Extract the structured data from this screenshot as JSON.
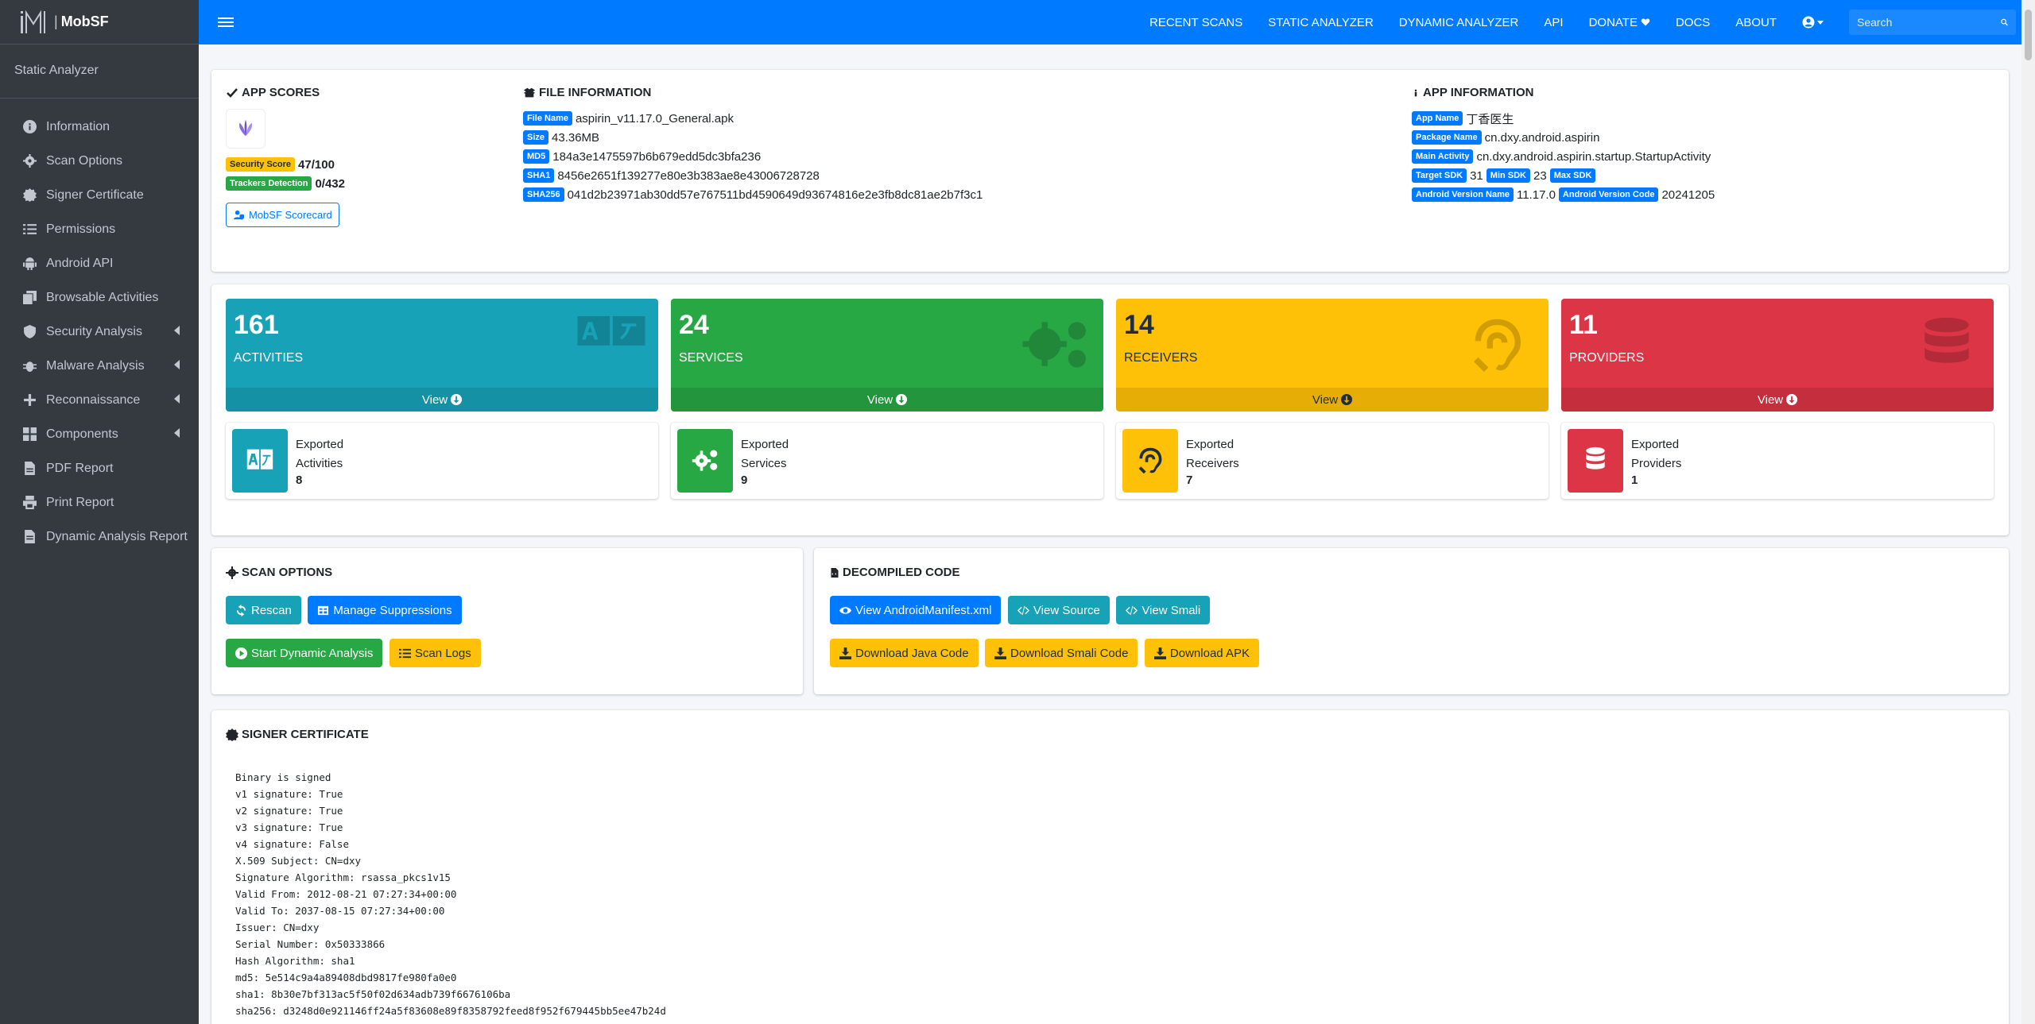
{
  "brand": {
    "name": "MobSF"
  },
  "sidebar": {
    "title": "Static Analyzer",
    "items": [
      {
        "label": "Information",
        "icon": "info-circle-icon",
        "submenu": false
      },
      {
        "label": "Scan Options",
        "icon": "cog-icon",
        "submenu": false
      },
      {
        "label": "Signer Certificate",
        "icon": "certificate-icon",
        "submenu": false
      },
      {
        "label": "Permissions",
        "icon": "list-icon",
        "submenu": false
      },
      {
        "label": "Android API",
        "icon": "android-icon",
        "submenu": false
      },
      {
        "label": "Browsable Activities",
        "icon": "clone-icon",
        "submenu": false
      },
      {
        "label": "Security Analysis",
        "icon": "shield-icon",
        "submenu": true
      },
      {
        "label": "Malware Analysis",
        "icon": "bug-icon",
        "submenu": true
      },
      {
        "label": "Reconnaissance",
        "icon": "plus-icon",
        "submenu": true
      },
      {
        "label": "Components",
        "icon": "th-large-icon",
        "submenu": true
      },
      {
        "label": "PDF Report",
        "icon": "file-pdf-icon",
        "submenu": false
      },
      {
        "label": "Print Report",
        "icon": "print-icon",
        "submenu": false
      },
      {
        "label": "Dynamic Analysis Report",
        "icon": "file-icon",
        "submenu": false
      }
    ]
  },
  "topnav": {
    "recent_scans": "RECENT SCANS",
    "static_analyzer": "STATIC ANALYZER",
    "dynamic_analyzer": "DYNAMIC ANALYZER",
    "api": "API",
    "donate": "DONATE",
    "docs": "DOCS",
    "about": "ABOUT",
    "search_placeholder": "Search"
  },
  "app_scores": {
    "title": "APP SCORES",
    "security_label": "Security Score",
    "security_value": "47/100",
    "trackers_label": "Trackers Detection",
    "trackers_value": "0/432",
    "scorecard_button": "MobSF Scorecard"
  },
  "file_info": {
    "title": "FILE INFORMATION",
    "rows": [
      {
        "label": "File Name",
        "value": "aspirin_v11.17.0_General.apk"
      },
      {
        "label": "Size",
        "value": "43.36MB"
      },
      {
        "label": "MD5",
        "value": "184a3e1475597b6b679edd5dc3bfa236"
      },
      {
        "label": "SHA1",
        "value": "8456e2651f139277e80e3b383ae8e43006728728"
      },
      {
        "label": "SHA256",
        "value": "041d2b23971ab30dd57e767511bd4590649d93674816e2e3fb8dc81ae2b7f3c1"
      }
    ]
  },
  "app_info": {
    "title": "APP INFORMATION",
    "app_name_label": "App Name",
    "app_name": "丁香医生",
    "package_label": "Package Name",
    "package": "cn.dxy.android.aspirin",
    "main_activity_label": "Main Activity",
    "main_activity": "cn.dxy.android.aspirin.startup.StartupActivity",
    "target_sdk_label": "Target SDK",
    "target_sdk": "31",
    "min_sdk_label": "Min SDK",
    "min_sdk": "23",
    "max_sdk_label": "Max SDK",
    "version_name_label": "Android Version Name",
    "version_name": "11.17.0",
    "version_code_label": "Android Version Code",
    "version_code": "20241205"
  },
  "stats": [
    {
      "count": "161",
      "label": "ACTIVITIES",
      "view": "View",
      "color": "#17a2b8",
      "exported_line1": "Exported",
      "exported_line2": "Activities",
      "exported_count": "8"
    },
    {
      "count": "24",
      "label": "SERVICES",
      "view": "View",
      "color": "#28a745",
      "exported_line1": "Exported",
      "exported_line2": "Services",
      "exported_count": "9"
    },
    {
      "count": "14",
      "label": "RECEIVERS",
      "view": "View",
      "color": "#ffc107",
      "exported_line1": "Exported",
      "exported_line2": "Receivers",
      "exported_count": "7"
    },
    {
      "count": "11",
      "label": "PROVIDERS",
      "view": "View",
      "color": "#dc3545",
      "exported_line1": "Exported",
      "exported_line2": "Providers",
      "exported_count": "1"
    }
  ],
  "scan_options": {
    "title": "SCAN OPTIONS",
    "rescan": "Rescan",
    "manage_suppressions": "Manage Suppressions",
    "start_dynamic": "Start Dynamic Analysis",
    "scan_logs": "Scan Logs"
  },
  "decompiled": {
    "title": "DECOMPILED CODE",
    "view_manifest": "View AndroidManifest.xml",
    "view_source": "View Source",
    "view_smali": "View Smali",
    "download_java": "Download Java Code",
    "download_smali": "Download Smali Code",
    "download_apk": "Download APK"
  },
  "signer": {
    "title": "SIGNER CERTIFICATE",
    "text": "Binary is signed\nv1 signature: True\nv2 signature: True\nv3 signature: True\nv4 signature: False\nX.509 Subject: CN=dxy\nSignature Algorithm: rsassa_pkcs1v15\nValid From: 2012-08-21 07:27:34+00:00\nValid To: 2037-08-15 07:27:34+00:00\nIssuer: CN=dxy\nSerial Number: 0x50333866\nHash Algorithm: sha1\nmd5: 5e514c9a4a89408dbd9817fe980fa0e0\nsha1: 8b30e7bf313ac5f50f02d634adb739f6676106ba\nsha256: d3248d0e921146ff24a5f83608e89f8358792feed8f952f679445bb5ee47b24d"
  }
}
